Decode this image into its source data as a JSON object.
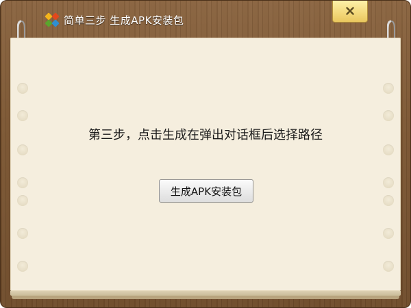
{
  "window": {
    "title": "简单三步  生成APK安装包",
    "close_label": "×"
  },
  "icons": {
    "app": "app-logo-icon",
    "close": "close-icon"
  },
  "content": {
    "message": "第三步，点击生成在弹出对话框后选择路径",
    "button_label": "生成APK安装包"
  },
  "colors": {
    "wood": "#7c5733",
    "paper": "#f5eede",
    "close_button": "#f3d87a"
  }
}
